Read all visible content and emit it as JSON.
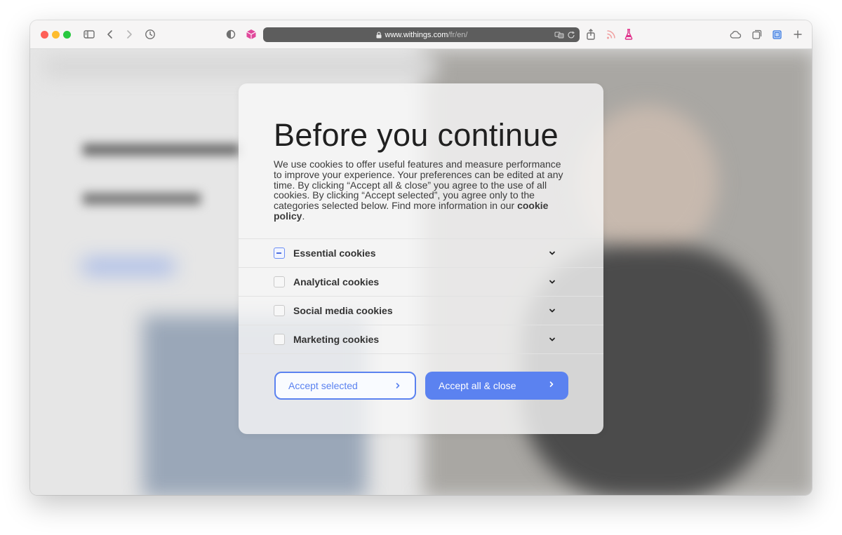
{
  "browser": {
    "url_domain": "www.withings.com",
    "url_path": "/fr/en/",
    "icons": [
      "sidebar-icon",
      "back-icon",
      "forward-icon",
      "history-icon",
      "shield-icon",
      "box-extension-icon",
      "lock-icon",
      "translate-icon",
      "reload-icon",
      "share-icon",
      "rss-icon",
      "flask-icon",
      "icloud-icon",
      "tabs-icon",
      "tab-overview-icon",
      "new-tab-icon"
    ]
  },
  "modal": {
    "title": "Before you continue",
    "description_before_link": "We use cookies to offer useful features and measure performance to improve your experience. Your preferences can be edited at any time. By clicking “Accept all & close” you agree to the use of all cookies. By clicking “Accept selected”, you agree only to the categories selected below. Find more information in our ",
    "link_text": "cookie policy",
    "description_after_link": ".",
    "categories": [
      {
        "label": "Essential cookies",
        "state": "partial"
      },
      {
        "label": "Analytical cookies",
        "state": "unchecked"
      },
      {
        "label": "Social media cookies",
        "state": "unchecked"
      },
      {
        "label": "Marketing cookies",
        "state": "unchecked"
      }
    ],
    "accept_selected_label": "Accept selected",
    "accept_all_label": "Accept all & close"
  },
  "colors": {
    "accent": "#5b82f0",
    "traffic_red": "#fe5f57",
    "traffic_yellow": "#febc2e",
    "traffic_green": "#28c840",
    "flask": "#e02f8a",
    "box_extension": "#e0489b"
  }
}
